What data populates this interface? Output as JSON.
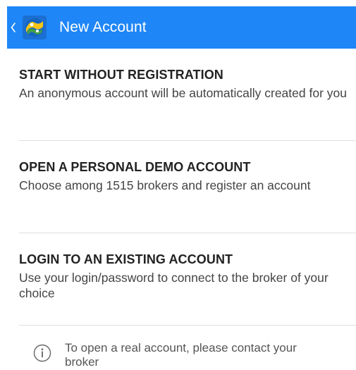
{
  "header": {
    "title": "New Account",
    "back_icon": "chevron-left-icon",
    "logo_icon": "metatrader-logo-icon",
    "background_color": "#1e86f7"
  },
  "options": [
    {
      "title": "START WITHOUT REGISTRATION",
      "description": "An anonymous account will be automatically created for you"
    },
    {
      "title": "OPEN A PERSONAL DEMO ACCOUNT",
      "description": "Choose among 1515 brokers and register an account"
    },
    {
      "title": "LOGIN TO AN EXISTING ACCOUNT",
      "description": "Use your login/password to connect to the broker of your choice"
    }
  ],
  "info": {
    "icon": "info-icon",
    "text": "To open a real account, please contact your broker"
  }
}
